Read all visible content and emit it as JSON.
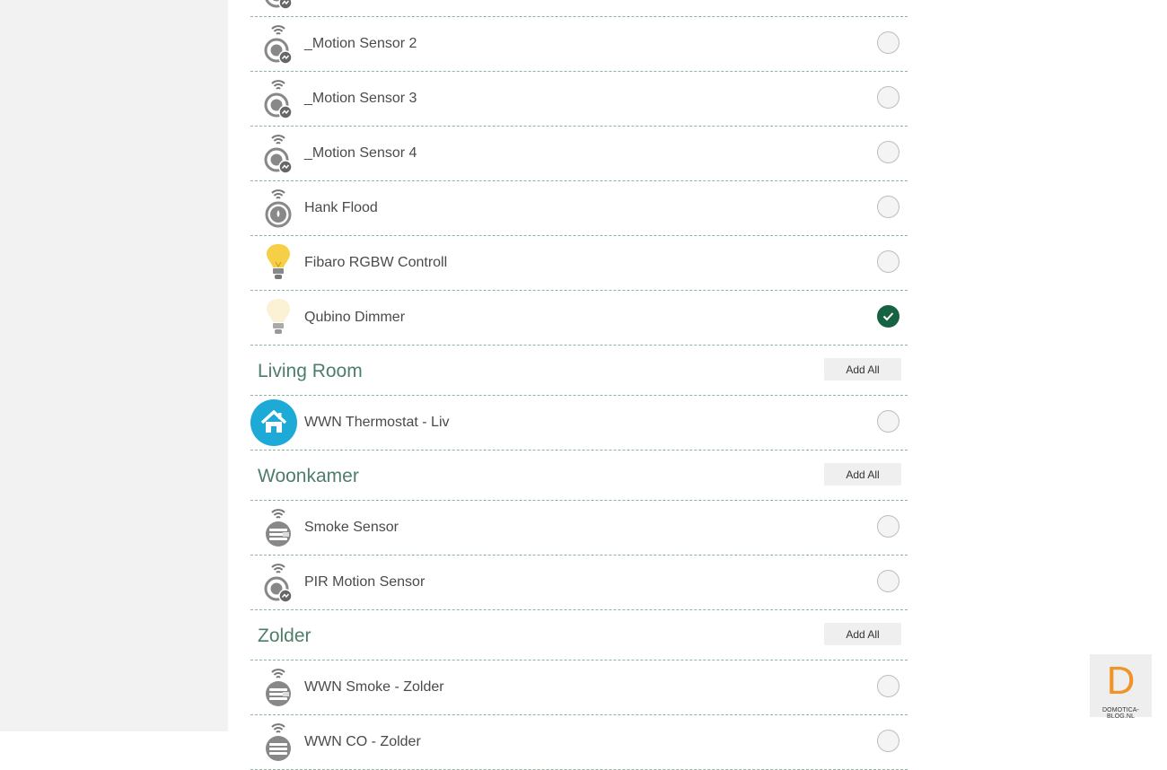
{
  "rows": [
    {
      "key": "prev",
      "label": "",
      "icon": "motion-sensor-icon",
      "checked": false
    },
    {
      "key": "motion2",
      "label": "_Motion Sensor 2",
      "icon": "motion-sensor-icon",
      "checked": false
    },
    {
      "key": "motion3",
      "label": "_Motion Sensor 3",
      "icon": "motion-sensor-icon",
      "checked": false
    },
    {
      "key": "motion4",
      "label": "_Motion Sensor 4",
      "icon": "motion-sensor-icon",
      "checked": false
    },
    {
      "key": "hank",
      "label": "Hank Flood",
      "icon": "flood-sensor-icon",
      "checked": false
    },
    {
      "key": "fibaro",
      "label": "Fibaro RGBW Controll",
      "icon": "bulb-on-icon",
      "checked": false
    },
    {
      "key": "qubino",
      "label": "Qubino Dimmer",
      "icon": "bulb-dim-icon",
      "checked": true
    }
  ],
  "sections": [
    {
      "title": "Living Room",
      "add_all": "Add All",
      "rows": [
        {
          "label": "WWN Thermostat - Liv",
          "icon": "home-icon",
          "checked": false
        }
      ]
    },
    {
      "title": "Woonkamer",
      "add_all": "Add All",
      "rows": [
        {
          "label": "Smoke Sensor",
          "icon": "smoke-sensor-icon",
          "checked": false
        },
        {
          "label": "PIR Motion Sensor",
          "icon": "motion-sensor-icon",
          "checked": false
        }
      ]
    },
    {
      "title": "Zolder",
      "add_all": "Add All",
      "rows": [
        {
          "label": "WWN Smoke - Zolder",
          "icon": "smoke-sensor-icon",
          "checked": false
        },
        {
          "label": "WWN CO - Zolder",
          "icon": "smoke-sensor-icon",
          "checked": false
        }
      ]
    }
  ],
  "watermark": {
    "letter": "D",
    "text": "DOMOTICA-BLOG.NL"
  },
  "colors": {
    "accent": "#166343",
    "section_title": "#4d7e6a",
    "watermark": "#f0932b"
  }
}
